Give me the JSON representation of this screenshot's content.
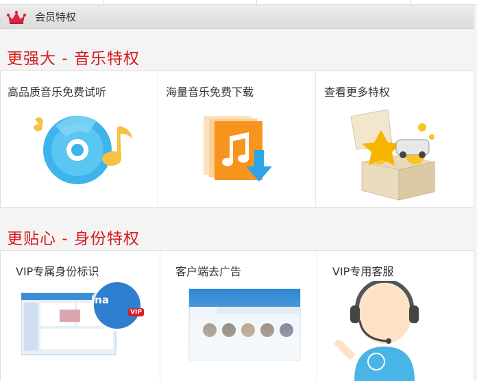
{
  "header": {
    "title": "会员特权"
  },
  "sections": [
    {
      "title": "更强大 - 音乐特权",
      "items": [
        {
          "label": "高品质音乐免费试听",
          "icon": "cd-music-icon"
        },
        {
          "label": "海量音乐免费下载",
          "icon": "music-download-icon"
        },
        {
          "label": "查看更多特权",
          "icon": "treasure-box-icon"
        }
      ]
    },
    {
      "title": "更贴心 - 身份特权",
      "items": [
        {
          "label": "VIP专属身份标识",
          "icon": "vip-badge-screenshot",
          "badge": "VIP",
          "name_fragment": "ina"
        },
        {
          "label": "客户端去广告",
          "icon": "ad-free-client-screenshot"
        },
        {
          "label": "VIP专用客服",
          "icon": "customer-service-icon"
        }
      ]
    }
  ],
  "colors": {
    "accent": "#d7191b",
    "blue": "#2aa6e8",
    "orange": "#f7941d"
  }
}
